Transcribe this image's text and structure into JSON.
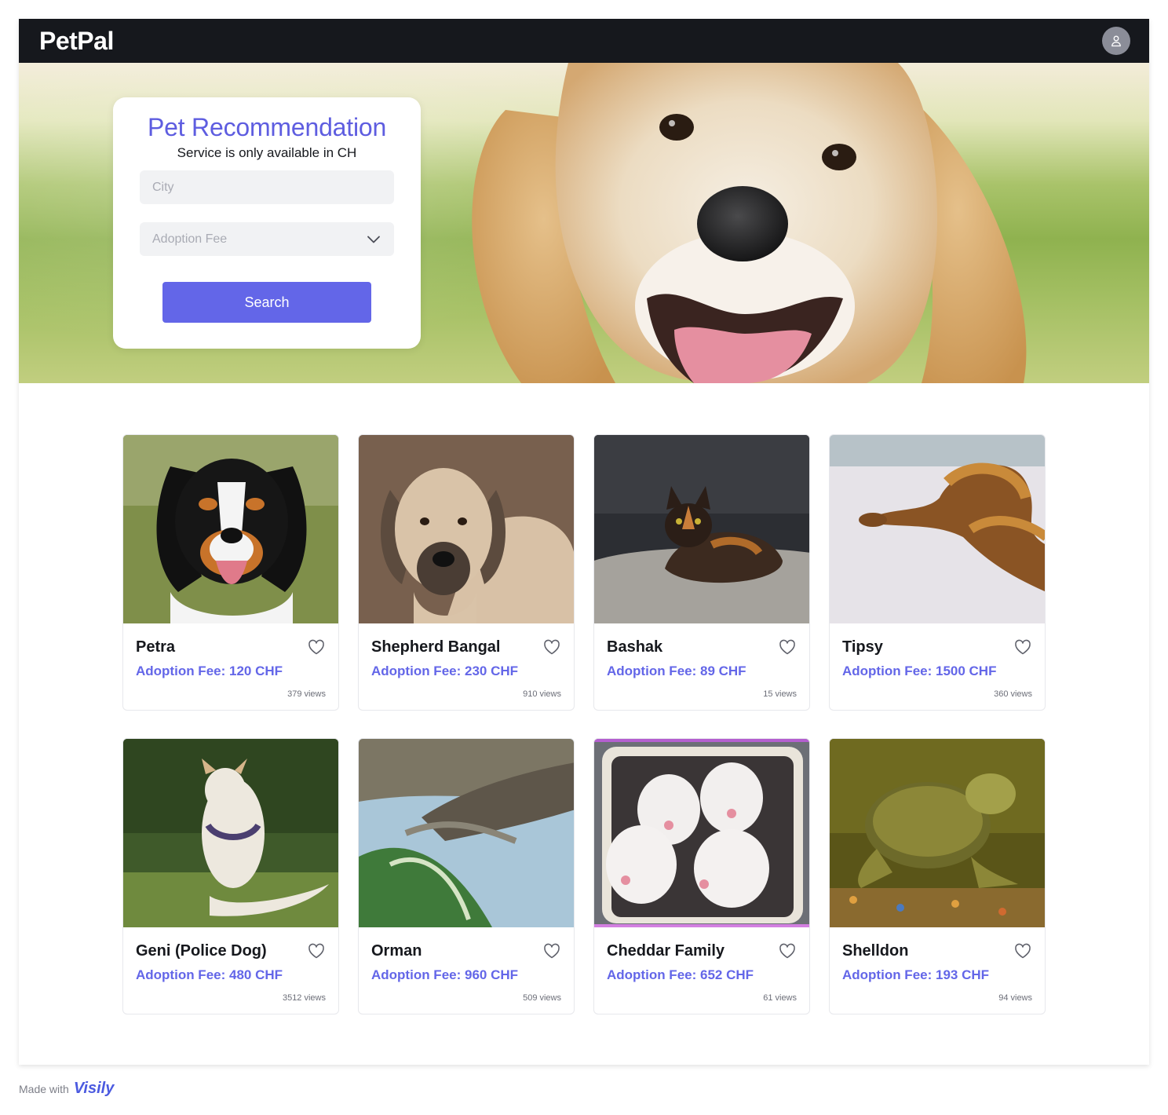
{
  "header": {
    "app_name": "PetPal",
    "avatar_icon": "user-icon"
  },
  "search": {
    "title": "Pet Recommendation",
    "subtitle": "Service is only available in CH",
    "city_placeholder": "City",
    "fee_placeholder": "Adoption Fee",
    "button_label": "Search"
  },
  "pets": [
    {
      "name": "Petra",
      "fee": "Adoption Fee: 120 CHF",
      "views": "379 views"
    },
    {
      "name": "Shepherd Bangal",
      "fee": "Adoption Fee: 230 CHF",
      "views": "910 views"
    },
    {
      "name": "Bashak",
      "fee": "Adoption Fee: 89 CHF",
      "views": "15 views"
    },
    {
      "name": "Tipsy",
      "fee": "Adoption Fee: 1500 CHF",
      "views": "360 views"
    },
    {
      "name": "Geni (Police Dog)",
      "fee": "Adoption Fee: 480 CHF",
      "views": "3512 views"
    },
    {
      "name": "Orman",
      "fee": "Adoption Fee: 960 CHF",
      "views": "509 views"
    },
    {
      "name": "Cheddar Family",
      "fee": "Adoption Fee: 652 CHF",
      "views": "61 views"
    },
    {
      "name": "Shelldon",
      "fee": "Adoption Fee: 193 CHF",
      "views": "94 views"
    }
  ],
  "footer": {
    "made_with": "Made with",
    "brand": "Visily"
  },
  "colors": {
    "accent": "#6366e8",
    "header_bg": "#16181d",
    "title": "#5e5de0"
  }
}
